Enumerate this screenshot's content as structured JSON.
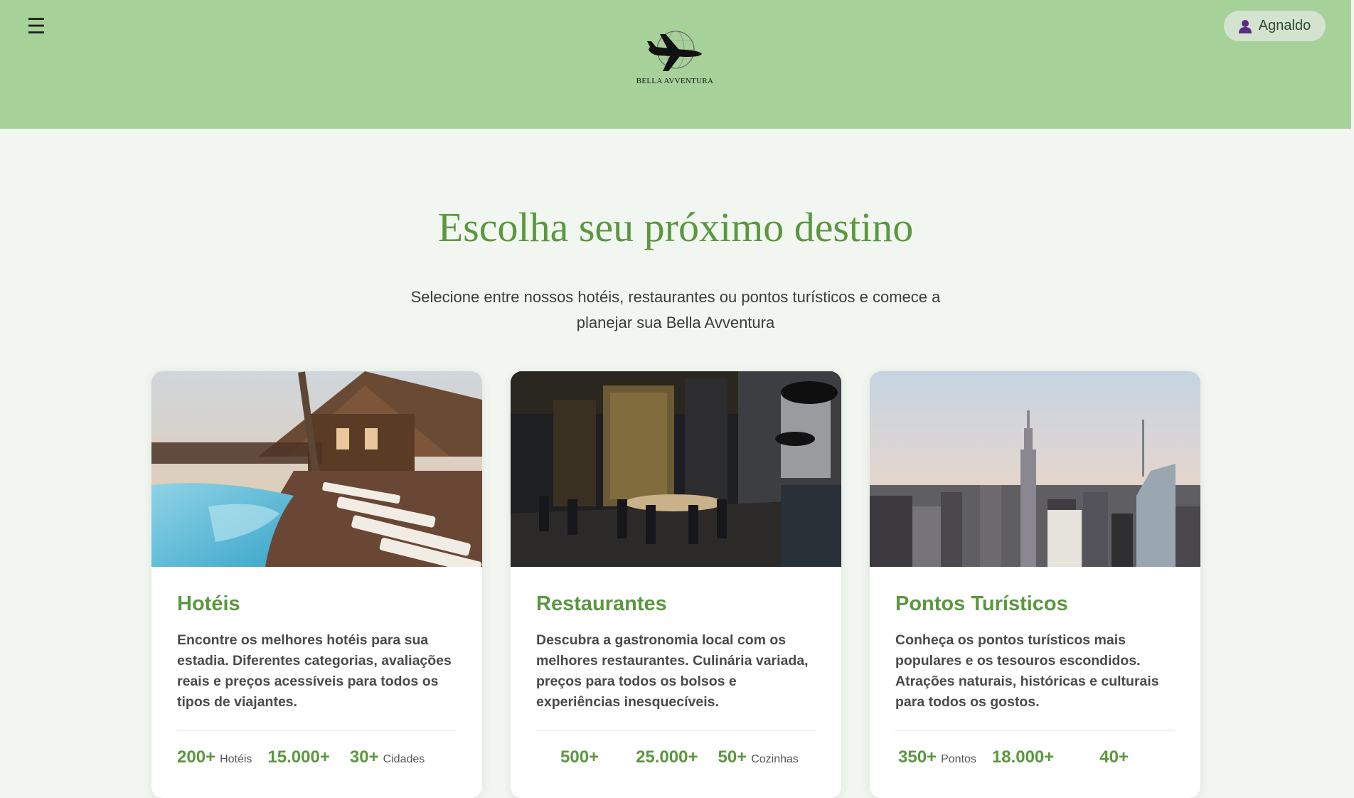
{
  "header": {
    "menu_icon": "hamburger-menu-icon",
    "logo_text": "BELLA AVVENTURA",
    "user_name": "Agnaldo",
    "user_icon": "user-icon",
    "bg_color": "#a6d198"
  },
  "hero": {
    "title": "Escolha seu próximo destino",
    "subtitle": "Selecione entre nossos hotéis, restaurantes ou pontos turísticos e comece a planejar sua Bella Avventura"
  },
  "cards": [
    {
      "title": "Hotéis",
      "description": "Encontre os melhores hotéis para sua estadia. Diferentes categorias, avaliações reais e preços acessíveis para todos os tipos de viajantes.",
      "stats": [
        {
          "value": "200+",
          "label": "Hotéis"
        },
        {
          "value": "15.000+",
          "label": ""
        },
        {
          "value": "30+",
          "label": "Cidades"
        }
      ]
    },
    {
      "title": "Restaurantes",
      "description": "Descubra a gastronomia local com os melhores restaurantes. Culinária variada, preços para todos os bolsos e experiências inesquecíveis.",
      "stats": [
        {
          "value": "500+",
          "label": ""
        },
        {
          "value": "25.000+",
          "label": ""
        },
        {
          "value": "50+",
          "label": "Cozinhas"
        }
      ]
    },
    {
      "title": "Pontos Turísticos",
      "description": "Conheça os pontos turísticos mais populares e os tesouros escondidos. Atrações naturais, históricas e culturais para todos os gostos.",
      "stats": [
        {
          "value": "350+",
          "label": "Pontos"
        },
        {
          "value": "18.000+",
          "label": ""
        },
        {
          "value": "40+",
          "label": ""
        }
      ]
    }
  ],
  "colors": {
    "accent": "#5b973f",
    "page_bg": "#f1f6f1"
  }
}
